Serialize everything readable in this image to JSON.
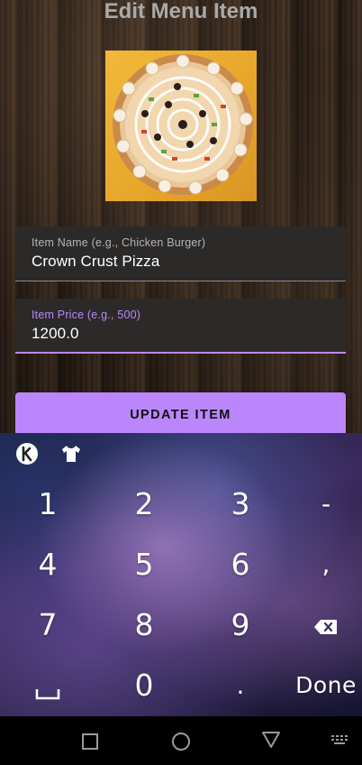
{
  "header": {
    "title": "Edit Menu Item"
  },
  "item_image": {
    "description_icon": "pizza-image"
  },
  "form": {
    "name_field": {
      "label": "Item Name (e.g., Chicken Burger)",
      "value": "Crown Crust Pizza"
    },
    "price_field": {
      "label": "Item Price (e.g., 500)",
      "value": "1200.0"
    },
    "update_button_label": "UPDATE ITEM"
  },
  "keyboard": {
    "top_icons": [
      "keyboard-brand-k-icon",
      "shirt-theme-icon"
    ],
    "rows": [
      [
        "1",
        "2",
        "3",
        "-"
      ],
      [
        "4",
        "5",
        "6",
        ","
      ],
      [
        "7",
        "8",
        "9",
        "backspace"
      ],
      [
        "space",
        "0",
        ".",
        "Done"
      ]
    ],
    "done_label": "Done"
  },
  "navbar": {
    "icons": [
      "square-recents-icon",
      "circle-home-icon",
      "triangle-back-icon",
      "keyboard-switch-icon"
    ]
  },
  "colors": {
    "accent": "#bb86fc",
    "field_bg": "#2c2a29",
    "title_color": "#a9a9a9"
  }
}
